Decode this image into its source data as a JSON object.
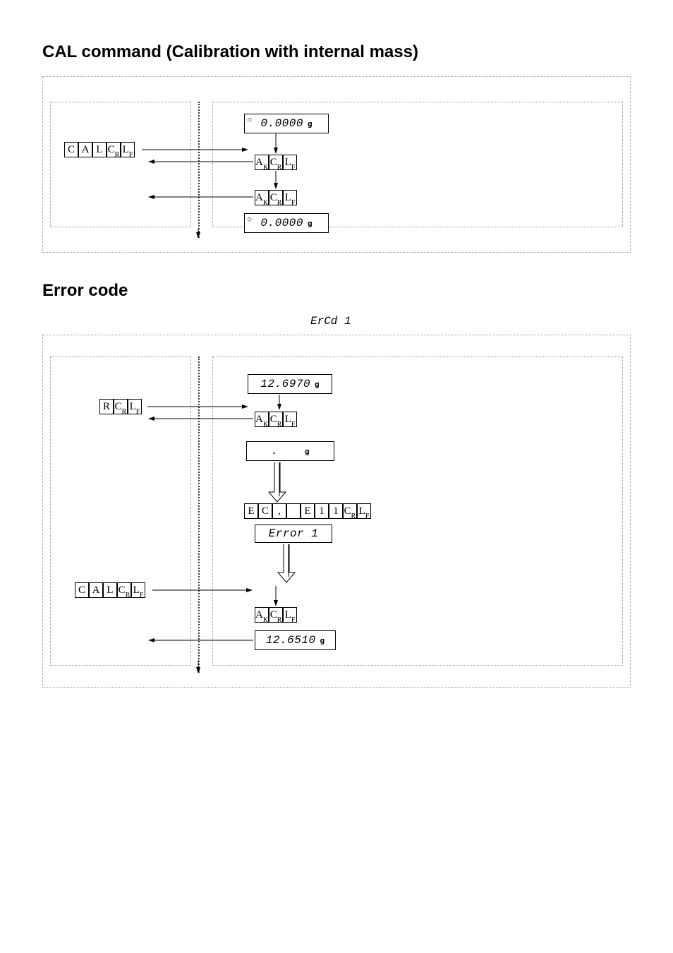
{
  "section1": {
    "title": "CAL command (Calibration with internal mass)",
    "cmd": [
      "C",
      "A",
      "L",
      "CR",
      "LF"
    ],
    "lcd1": "0.0000",
    "lcd1_unit": "g",
    "ack1": [
      "AK",
      "CR",
      "LF"
    ],
    "ack2": [
      "AK",
      "CR",
      "LF"
    ],
    "lcd2": "0.0000",
    "lcd2_unit": "g"
  },
  "section2": {
    "title": "Error code",
    "ercd": "ErCd 1",
    "cmd_r": [
      "R",
      "CR",
      "LF"
    ],
    "lcd1": "12.6970",
    "lcd1_unit": "g",
    "ack1": [
      "AK",
      "CR",
      "LF"
    ],
    "lcd_blank": ".",
    "lcd_blank_unit": "g",
    "ec_row": [
      "E",
      "C",
      ",",
      "",
      "E",
      "1",
      "1",
      "CR",
      "LF"
    ],
    "err_lcd": "Error 1",
    "cmd_cal": [
      "C",
      "A",
      "L",
      "CR",
      "LF"
    ],
    "ack2": [
      "AK",
      "CR",
      "LF"
    ],
    "lcd3": "12.6510",
    "lcd3_unit": "g"
  }
}
